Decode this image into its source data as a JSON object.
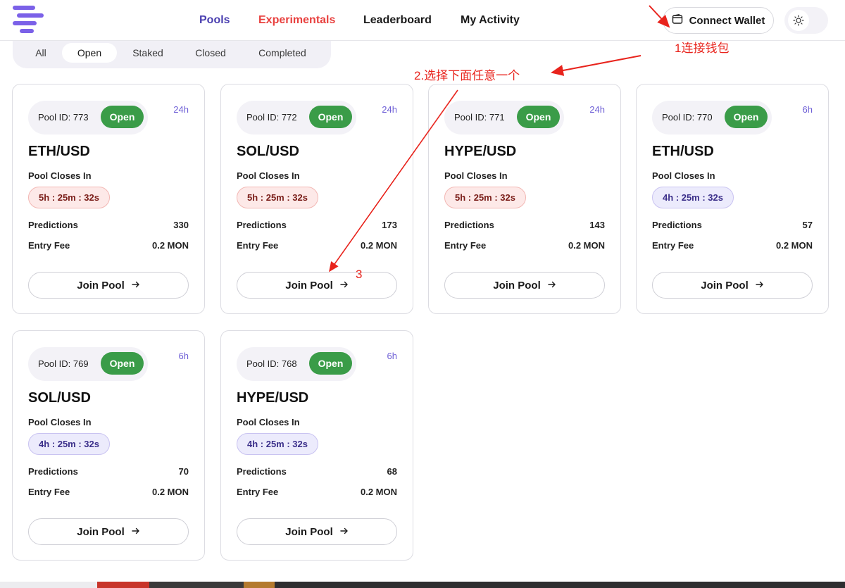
{
  "nav": {
    "items": [
      {
        "label": "Pools",
        "color": "#4a3fb0"
      },
      {
        "label": "Experimentals",
        "color": "#e8413f"
      },
      {
        "label": "Leaderboard",
        "color": "#1a1a1a"
      },
      {
        "label": "My Activity",
        "color": "#1a1a1a"
      }
    ],
    "connect_wallet": "Connect Wallet"
  },
  "filters": {
    "tabs": [
      "All",
      "Open",
      "Staked",
      "Closed",
      "Completed"
    ],
    "active": "Open"
  },
  "card_labels": {
    "pool_id_prefix": "Pool ID: ",
    "status": "Open",
    "closes_in": "Pool Closes In",
    "predictions": "Predictions",
    "entry_fee": "Entry Fee",
    "join": "Join Pool"
  },
  "pools": [
    {
      "pool_id": "Pool ID: 773",
      "status": "Open",
      "duration": "24h",
      "pair": "ETH/USD",
      "countdown": "5h : 25m : 32s",
      "countdown_tone": "red",
      "predictions": "330",
      "entry_fee": "0.2 MON"
    },
    {
      "pool_id": "Pool ID: 772",
      "status": "Open",
      "duration": "24h",
      "pair": "SOL/USD",
      "countdown": "5h : 25m : 32s",
      "countdown_tone": "red",
      "predictions": "173",
      "entry_fee": "0.2 MON"
    },
    {
      "pool_id": "Pool ID: 771",
      "status": "Open",
      "duration": "24h",
      "pair": "HYPE/USD",
      "countdown": "5h : 25m : 32s",
      "countdown_tone": "red",
      "predictions": "143",
      "entry_fee": "0.2 MON"
    },
    {
      "pool_id": "Pool ID: 770",
      "status": "Open",
      "duration": "6h",
      "pair": "ETH/USD",
      "countdown": "4h : 25m : 32s",
      "countdown_tone": "purple",
      "predictions": "57",
      "entry_fee": "0.2 MON"
    },
    {
      "pool_id": "Pool ID: 769",
      "status": "Open",
      "duration": "6h",
      "pair": "SOL/USD",
      "countdown": "4h : 25m : 32s",
      "countdown_tone": "purple",
      "predictions": "70",
      "entry_fee": "0.2 MON"
    },
    {
      "pool_id": "Pool ID: 768",
      "status": "Open",
      "duration": "6h",
      "pair": "HYPE/USD",
      "countdown": "4h : 25m : 32s",
      "countdown_tone": "purple",
      "predictions": "68",
      "entry_fee": "0.2 MON"
    }
  ],
  "annotations": {
    "step1": "1连接钱包",
    "step2": "2.选择下面任意一个",
    "step3": "3",
    "color": "#e8231c"
  },
  "colors": {
    "brand": "#7b61e8",
    "open_badge": "#3a9c48",
    "duration_text": "#6e5fd6"
  }
}
